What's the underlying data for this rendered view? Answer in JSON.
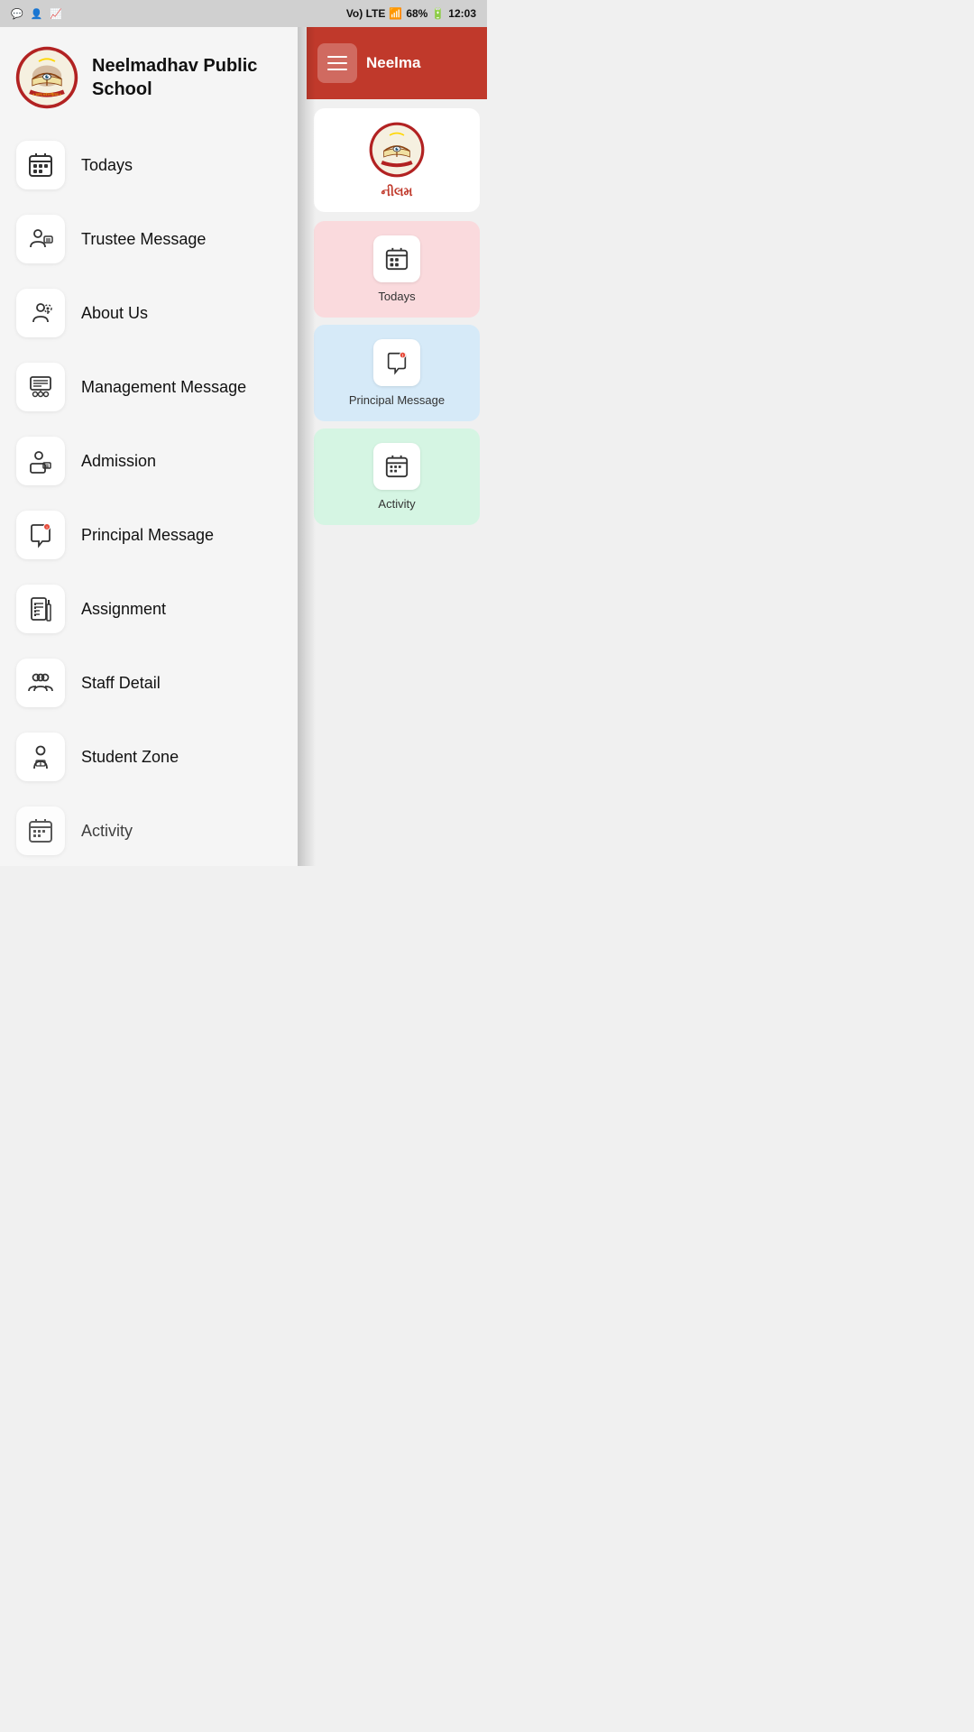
{
  "statusBar": {
    "time": "12:03",
    "battery": "68%",
    "network": "Vo) LTE"
  },
  "drawer": {
    "schoolName": "Neelmadhav Public School",
    "menuItems": [
      {
        "id": "todays",
        "label": "Todays",
        "icon": "calendar-grid"
      },
      {
        "id": "trustee-message",
        "label": "Trustee Message",
        "icon": "trustee"
      },
      {
        "id": "about-us",
        "label": "About Us",
        "icon": "about"
      },
      {
        "id": "management-message",
        "label": "Management Message",
        "icon": "management"
      },
      {
        "id": "admission",
        "label": "Admission",
        "icon": "admission"
      },
      {
        "id": "principal-message",
        "label": "Principal Message",
        "icon": "principal-msg"
      },
      {
        "id": "assignment",
        "label": "Assignment",
        "icon": "assignment"
      },
      {
        "id": "staff-detail",
        "label": "Staff Detail",
        "icon": "staff"
      },
      {
        "id": "student-zone",
        "label": "Student Zone",
        "icon": "student"
      },
      {
        "id": "activity",
        "label": "Activity",
        "icon": "activity-cal"
      }
    ]
  },
  "rightPanel": {
    "headerText": "Neelma",
    "schoolNameGujarati": "નીલમ",
    "gridItems": [
      {
        "id": "todays-grid",
        "label": "Todays",
        "color": "pink"
      },
      {
        "id": "principal-grid",
        "label": "Principal Message",
        "color": "blue"
      },
      {
        "id": "activity-grid",
        "label": "Activity",
        "color": "mint"
      }
    ]
  }
}
